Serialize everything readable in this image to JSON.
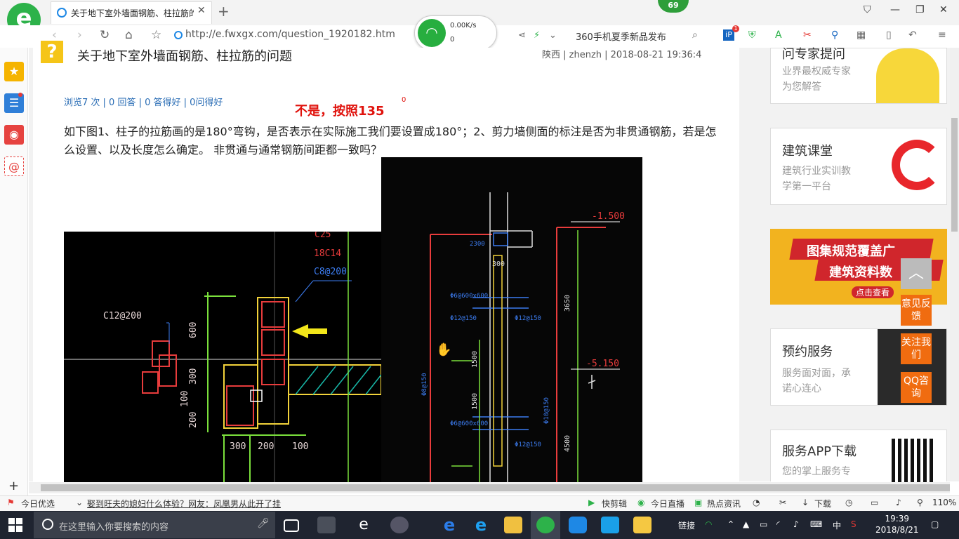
{
  "browser": {
    "logo_letter": "e",
    "tab_title": "关于地下室外墙面钢筋、柱拉筋的",
    "badge_count": "69",
    "url": "http://e.fwxgx.com/question_1920182.htm",
    "wifi_speed": "0.00K/s",
    "wifi_devices": "0",
    "news_ticker": "360手机夏季新品发布",
    "ext_badge": "1"
  },
  "question": {
    "title": "关于地下室外墙面钢筋、柱拉筋的问题",
    "meta": "陕西 | zhenzh | 2018-08-21 19:36:4",
    "stats": "浏览7 次 | 0 回答 | 0 答得好 | 0问得好",
    "answer_note": "不是，按照135",
    "answer_sup": "0",
    "body": "如下图1、柱子的拉筋画的是180°弯钩，是否表示在实际施工我们要设置成180°；2、剪力墙侧面的标注是否为非贯通钢筋，若是怎么设置、以及长度怎么确定。 非贯通与通常钢筋间距都一致吗？"
  },
  "figure1": {
    "labels": [
      "C12@200",
      "18C14",
      "C8@200",
      "600",
      "300",
      "100",
      "200",
      "300",
      "200",
      "100",
      "C25"
    ]
  },
  "figure2": {
    "labels": [
      "-1.500",
      "-5.150",
      "300",
      "3650",
      "2300",
      "1500",
      "1500",
      "Φ12@150",
      "Φ8@150",
      "Φ6@600x600",
      "Φ12@150",
      "Φ6@600x600",
      "Φ12@150",
      "4500",
      "Φ10@150"
    ]
  },
  "sidebar_right": {
    "expert_title": "问专家提问",
    "expert_sub1": "业界最权威专家",
    "expert_sub2": "为您解答",
    "class_title": "建筑课堂",
    "class_sub1": "建筑行业实训教",
    "class_sub2": "学第一平台",
    "banner_line1": "图集规范覆盖广",
    "banner_line2": "建筑资料数",
    "banner_btn": "点击查看",
    "service_title": "预约服务",
    "service_sub1": "服务面对面，承",
    "service_sub2": "诺心连心",
    "app_title": "服务APP下载",
    "app_sub": "您的掌上服务专"
  },
  "float_buttons": {
    "feedback": "意见反馈",
    "follow": "关注我们",
    "qq": "QQ咨询"
  },
  "statusbar": {
    "today": "今日优选",
    "headline": "娶到旺夫的媳妇什么体验？网友：凤凰男从此开了挂",
    "quick_clip": "快剪辑",
    "live": "今日直播",
    "hot": "热点资讯",
    "download": "下载",
    "zoom": "110%"
  },
  "taskbar": {
    "search_placeholder": "在这里输入你要搜索的内容",
    "link_label": "链接",
    "ime": "中",
    "time": "19:39",
    "date": "2018/8/21"
  },
  "colors": {
    "brand_green": "#2db24a",
    "answer_red": "#e0120c",
    "link_blue": "#2a6db5",
    "float_orange": "#f06c10"
  }
}
